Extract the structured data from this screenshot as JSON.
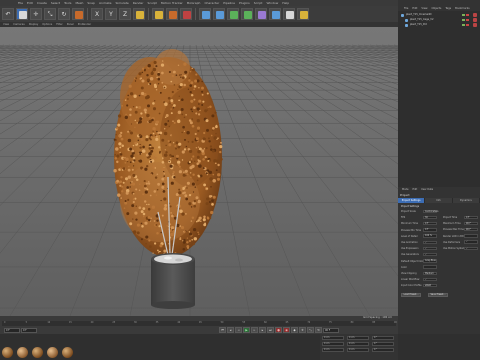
{
  "menubar": {
    "items": [
      "File",
      "Edit",
      "Create",
      "Select",
      "Tools",
      "Mesh",
      "Snap",
      "Animate",
      "Simulate",
      "Render",
      "Sculpt",
      "Motion Tracker",
      "MoGraph",
      "Character",
      "Pipeline",
      "Plugins",
      "Script",
      "Window",
      "Help"
    ]
  },
  "object_manager": {
    "tabs": [
      "File",
      "Edit",
      "View",
      "Objects",
      "Tags",
      "Bookmarks"
    ],
    "objects": [
      "plant_T15_Cinema4D",
      "plant_T15_Cage_V2",
      "plant_T15_Pot"
    ]
  },
  "viewport": {
    "menu": [
      "View",
      "Cameras",
      "Display",
      "Options",
      "Filter",
      "Panel",
      "ProRender"
    ],
    "status": "Grid Spacing : 100 cm"
  },
  "timeline": {
    "ticks": [
      "0",
      "5",
      "10",
      "15",
      "20",
      "25",
      "30",
      "35",
      "40",
      "45",
      "50",
      "55",
      "60",
      "65",
      "70",
      "75",
      "80",
      "85",
      "90"
    ],
    "start_frame": "0 F",
    "current_frame": "0 F",
    "end_frame": "90 F"
  },
  "coordinates": {
    "rows": [
      [
        "0 cm",
        "0 cm",
        "0 °"
      ],
      [
        "0 cm",
        "0 cm",
        "0 °"
      ],
      [
        "0 cm",
        "0 cm",
        "0 °"
      ]
    ]
  },
  "attribute_manager": {
    "menu": [
      "Mode",
      "Edit",
      "User Data"
    ],
    "title": "Project",
    "tabs": [
      "Project Settings",
      "Info",
      "Dynamics"
    ],
    "section": "Project Settings",
    "fields": [
      {
        "label": "Project Scale",
        "value": "Centimeters"
      },
      {
        "label": "FPS",
        "value": "30"
      },
      {
        "label": "Minimum Time",
        "value": "0 F"
      },
      {
        "label": "Preview Min Time",
        "value": "0 F"
      },
      {
        "label": "Level of Detail",
        "value": "100 %"
      },
      {
        "label": "Use Animation",
        "value": "✓"
      },
      {
        "label": "Use Expression",
        "value": "✓"
      },
      {
        "label": "Use Generators",
        "value": "✓"
      },
      {
        "label": "Default Object Color",
        "value": "Gray-Blue"
      },
      {
        "label": "Color",
        "value": ""
      },
      {
        "label": "View Clipping",
        "value": "Medium"
      },
      {
        "label": "Linear Workflow",
        "value": "✓"
      },
      {
        "label": "Input Color Profile",
        "value": "sRGB"
      }
    ],
    "right_fields": [
      {
        "label": "Project Time",
        "value": "0 F"
      },
      {
        "label": "Maximum Time",
        "value": "90 F"
      },
      {
        "label": "Preview Max Time",
        "value": "90 F"
      },
      {
        "label": "Render LOD in Editor",
        "value": ""
      },
      {
        "label": "Use Deformers",
        "value": "✓"
      },
      {
        "label": "Use Motion System",
        "value": "✓"
      }
    ],
    "buttons": [
      "Load Preset...",
      "Save Preset..."
    ]
  },
  "colors": {
    "accent": "#3c6db4",
    "viewport_bg": "#6b6b6b",
    "foliage": "#a8662a",
    "pot": "#4a4a4a"
  }
}
